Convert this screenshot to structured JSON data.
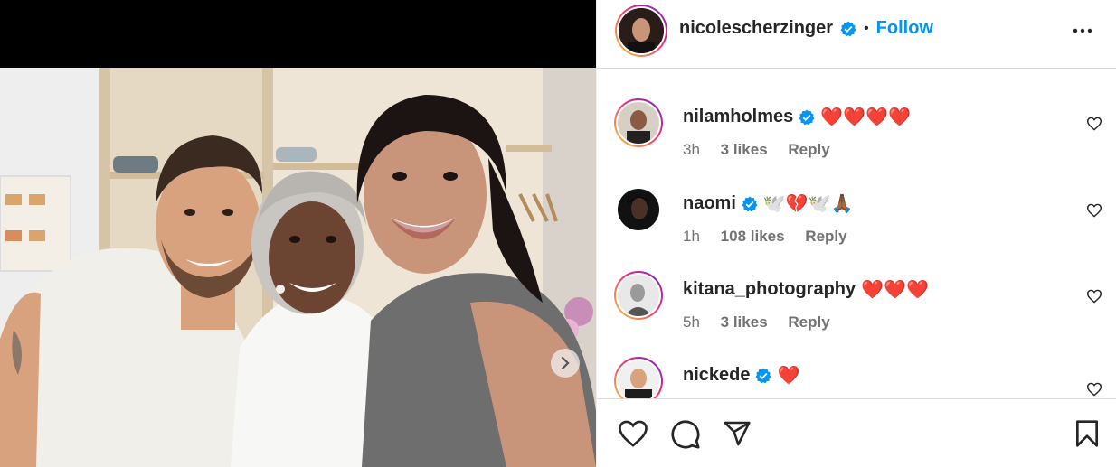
{
  "post": {
    "author": "nicolescherzinger",
    "separator": "•",
    "follow_label": "Follow"
  },
  "comments": [
    {
      "username": "nilamholmes",
      "text": "❤️❤️❤️❤️",
      "time": "3h",
      "likes": "3 likes",
      "reply": "Reply",
      "verified": true
    },
    {
      "username": "naomi",
      "text": "🕊️💔🕊️🙏🏾",
      "time": "1h",
      "likes": "108 likes",
      "reply": "Reply",
      "verified": true
    },
    {
      "username": "kitana_photography",
      "text": "❤️❤️❤️",
      "time": "5h",
      "likes": "3 likes",
      "reply": "Reply",
      "verified": false
    },
    {
      "username": "nickede",
      "text": "❤️",
      "verified": true
    }
  ],
  "colors": {
    "accent": "#0095f6",
    "verified": "#0095f6",
    "ring": "#ee2a7b"
  },
  "icons": [
    "verified-badge-icon",
    "more-options-icon",
    "heart-icon",
    "comment-icon",
    "share-icon",
    "bookmark-icon",
    "chevron-right-icon"
  ]
}
